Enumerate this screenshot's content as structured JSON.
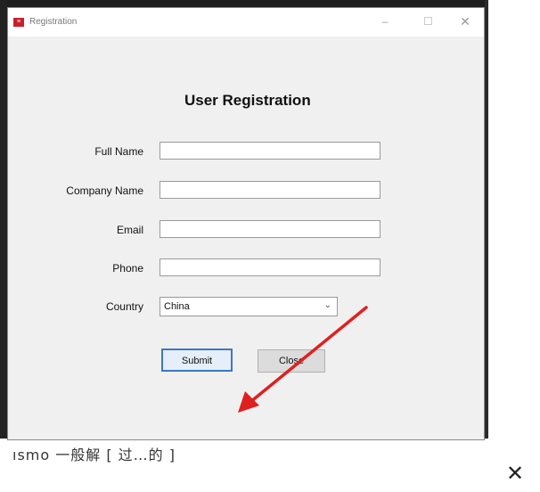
{
  "window": {
    "title": "Registration",
    "icon": "app-icon",
    "controls": {
      "minimize": "–",
      "close": "✕"
    }
  },
  "form": {
    "heading": "User Registration",
    "fields": [
      {
        "label": "Full Name",
        "value": ""
      },
      {
        "label": "Company Name",
        "value": ""
      },
      {
        "label": "Email",
        "value": ""
      },
      {
        "label": "Phone",
        "value": ""
      }
    ],
    "country": {
      "label": "Country",
      "value": "China"
    },
    "buttons": {
      "submit": "Submit",
      "close": "Close"
    }
  },
  "overlay": {
    "background_text": "ısmo 一般解 [ 过…的 ]",
    "dialog_close": "✕",
    "arrow_color": "#e02020"
  }
}
